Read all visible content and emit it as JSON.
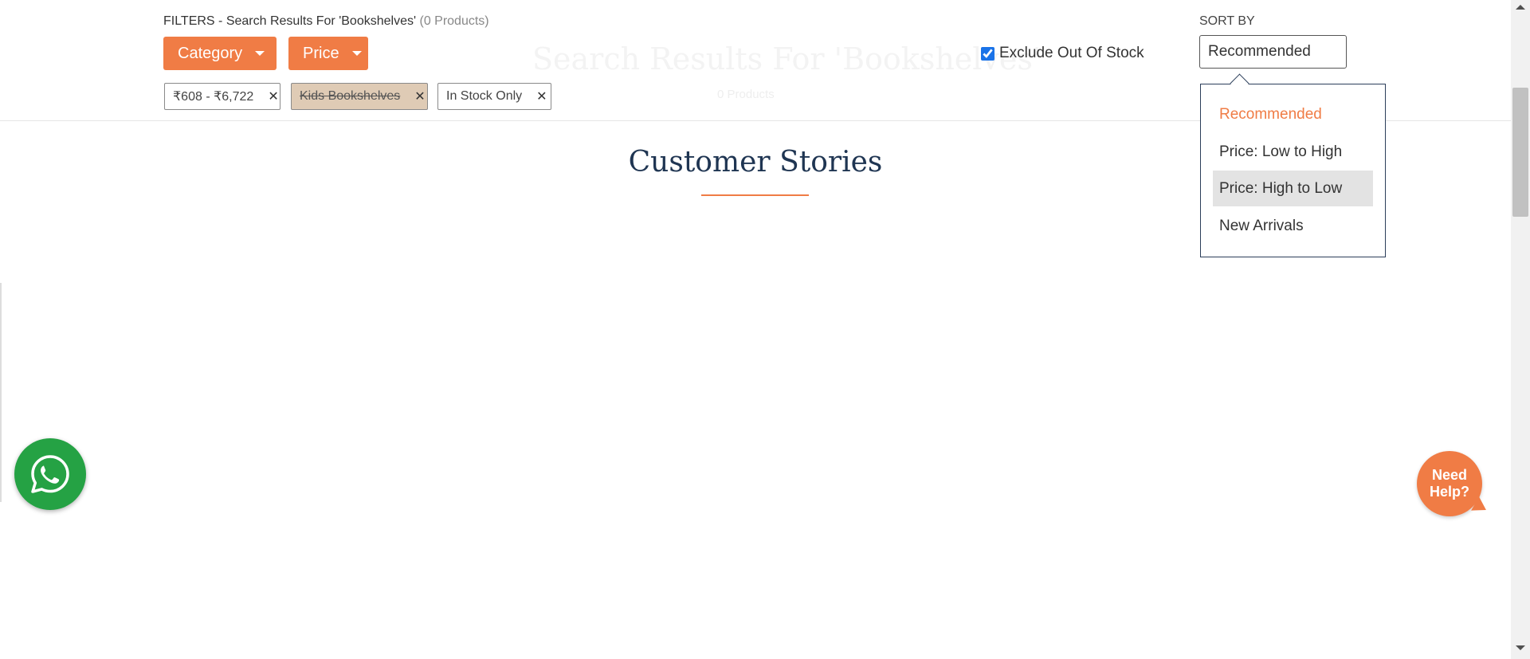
{
  "ghost": {
    "title": "Search Results For 'Bookshelves'",
    "subtitle": "0 Products"
  },
  "filters": {
    "header_label": "FILTERS - Search Results For 'Bookshelves'",
    "header_count": "(0 Products)",
    "category_label": "Category",
    "price_label": "Price",
    "chips": [
      {
        "label": "₹608 - ₹6,722",
        "remove_icon": "close-icon"
      },
      {
        "label": "Kids Bookshelves",
        "remove_icon": "close-icon",
        "state": "strikethrough"
      },
      {
        "label": "In Stock Only",
        "remove_icon": "close-icon"
      }
    ],
    "exclude_out_of_stock": {
      "label": "Exclude Out Of Stock",
      "checked": true
    }
  },
  "sort": {
    "label": "SORT BY",
    "selected": "Recommended",
    "options": [
      {
        "label": "Recommended",
        "state": "active"
      },
      {
        "label": "Price: Low to High"
      },
      {
        "label": "Price: High to Low",
        "state": "hover"
      },
      {
        "label": "New Arrivals"
      }
    ]
  },
  "section": {
    "title": "Customer Stories"
  },
  "floating": {
    "whatsapp_icon": "whatsapp-icon",
    "help_label": "Need Help?"
  },
  "colors": {
    "accent": "#f07c45",
    "heading": "#1f3552",
    "chip_disabled": "#dfcbb5",
    "whatsapp": "#25a244"
  }
}
